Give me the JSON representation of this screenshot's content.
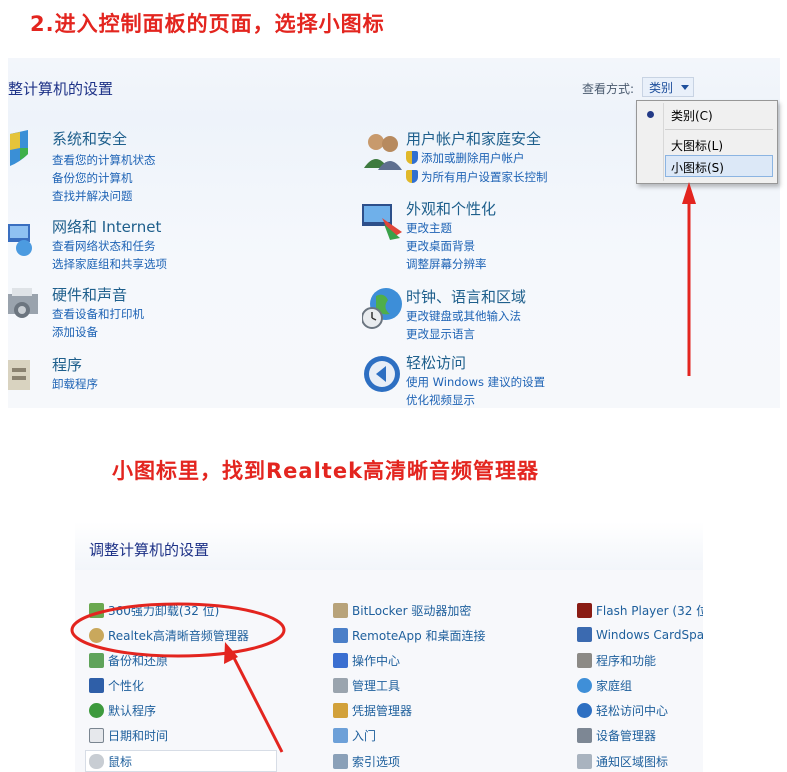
{
  "captions": {
    "step2": "2.进入控制面板的页面，选择小图标",
    "small_icons": "小图标里，找到Realtek高清晰音频管理器"
  },
  "category_view": {
    "title": "整计算机的设置",
    "view_by_label": "查看方式:",
    "view_by_value": "类别",
    "categories": [
      {
        "title": "系统和安全",
        "links": [
          "查看您的计算机状态",
          "备份您的计算机",
          "查找并解决问题"
        ]
      },
      {
        "title": "网络和 Internet",
        "links": [
          "查看网络状态和任务",
          "选择家庭组和共享选项"
        ]
      },
      {
        "title": "硬件和声音",
        "links": [
          "查看设备和打印机",
          "添加设备"
        ]
      },
      {
        "title": "程序",
        "links": [
          "卸载程序"
        ]
      },
      {
        "title": "用户帐户和家庭安全",
        "links": [
          "添加或删除用户帐户",
          "为所有用户设置家长控制"
        ]
      },
      {
        "title": "外观和个性化",
        "links": [
          "更改主题",
          "更改桌面背景",
          "调整屏幕分辨率"
        ]
      },
      {
        "title": "时钟、语言和区域",
        "links": [
          "更改键盘或其他输入法",
          "更改显示语言"
        ]
      },
      {
        "title": "轻松访问",
        "links": [
          "使用 Windows 建议的设置",
          "优化视频显示"
        ]
      }
    ],
    "menu": {
      "items": [
        "类别(C)",
        "大图标(L)",
        "小图标(S)"
      ],
      "selected": "类别(C)",
      "hovered": "小图标(S)"
    }
  },
  "small_icon_view": {
    "title": "调整计算机的设置",
    "columns": [
      [
        "360强力卸载(32 位)",
        "Realtek高清晰音频管理器",
        "备份和还原",
        "个性化",
        "默认程序",
        "日期和时间",
        "鼠标"
      ],
      [
        "BitLocker 驱动器加密",
        "RemoteApp 和桌面连接",
        "操作中心",
        "管理工具",
        "凭据管理器",
        "入门",
        "索引选项"
      ],
      [
        "Flash Player (32 位",
        "Windows CardSpa",
        "程序和功能",
        "家庭组",
        "轻松访问中心",
        "设备管理器",
        "通知区域图标"
      ]
    ]
  },
  "colors": {
    "annotation_red": "#e3251f",
    "link_blue": "#1e63b5",
    "title_blue": "#1e3287"
  }
}
